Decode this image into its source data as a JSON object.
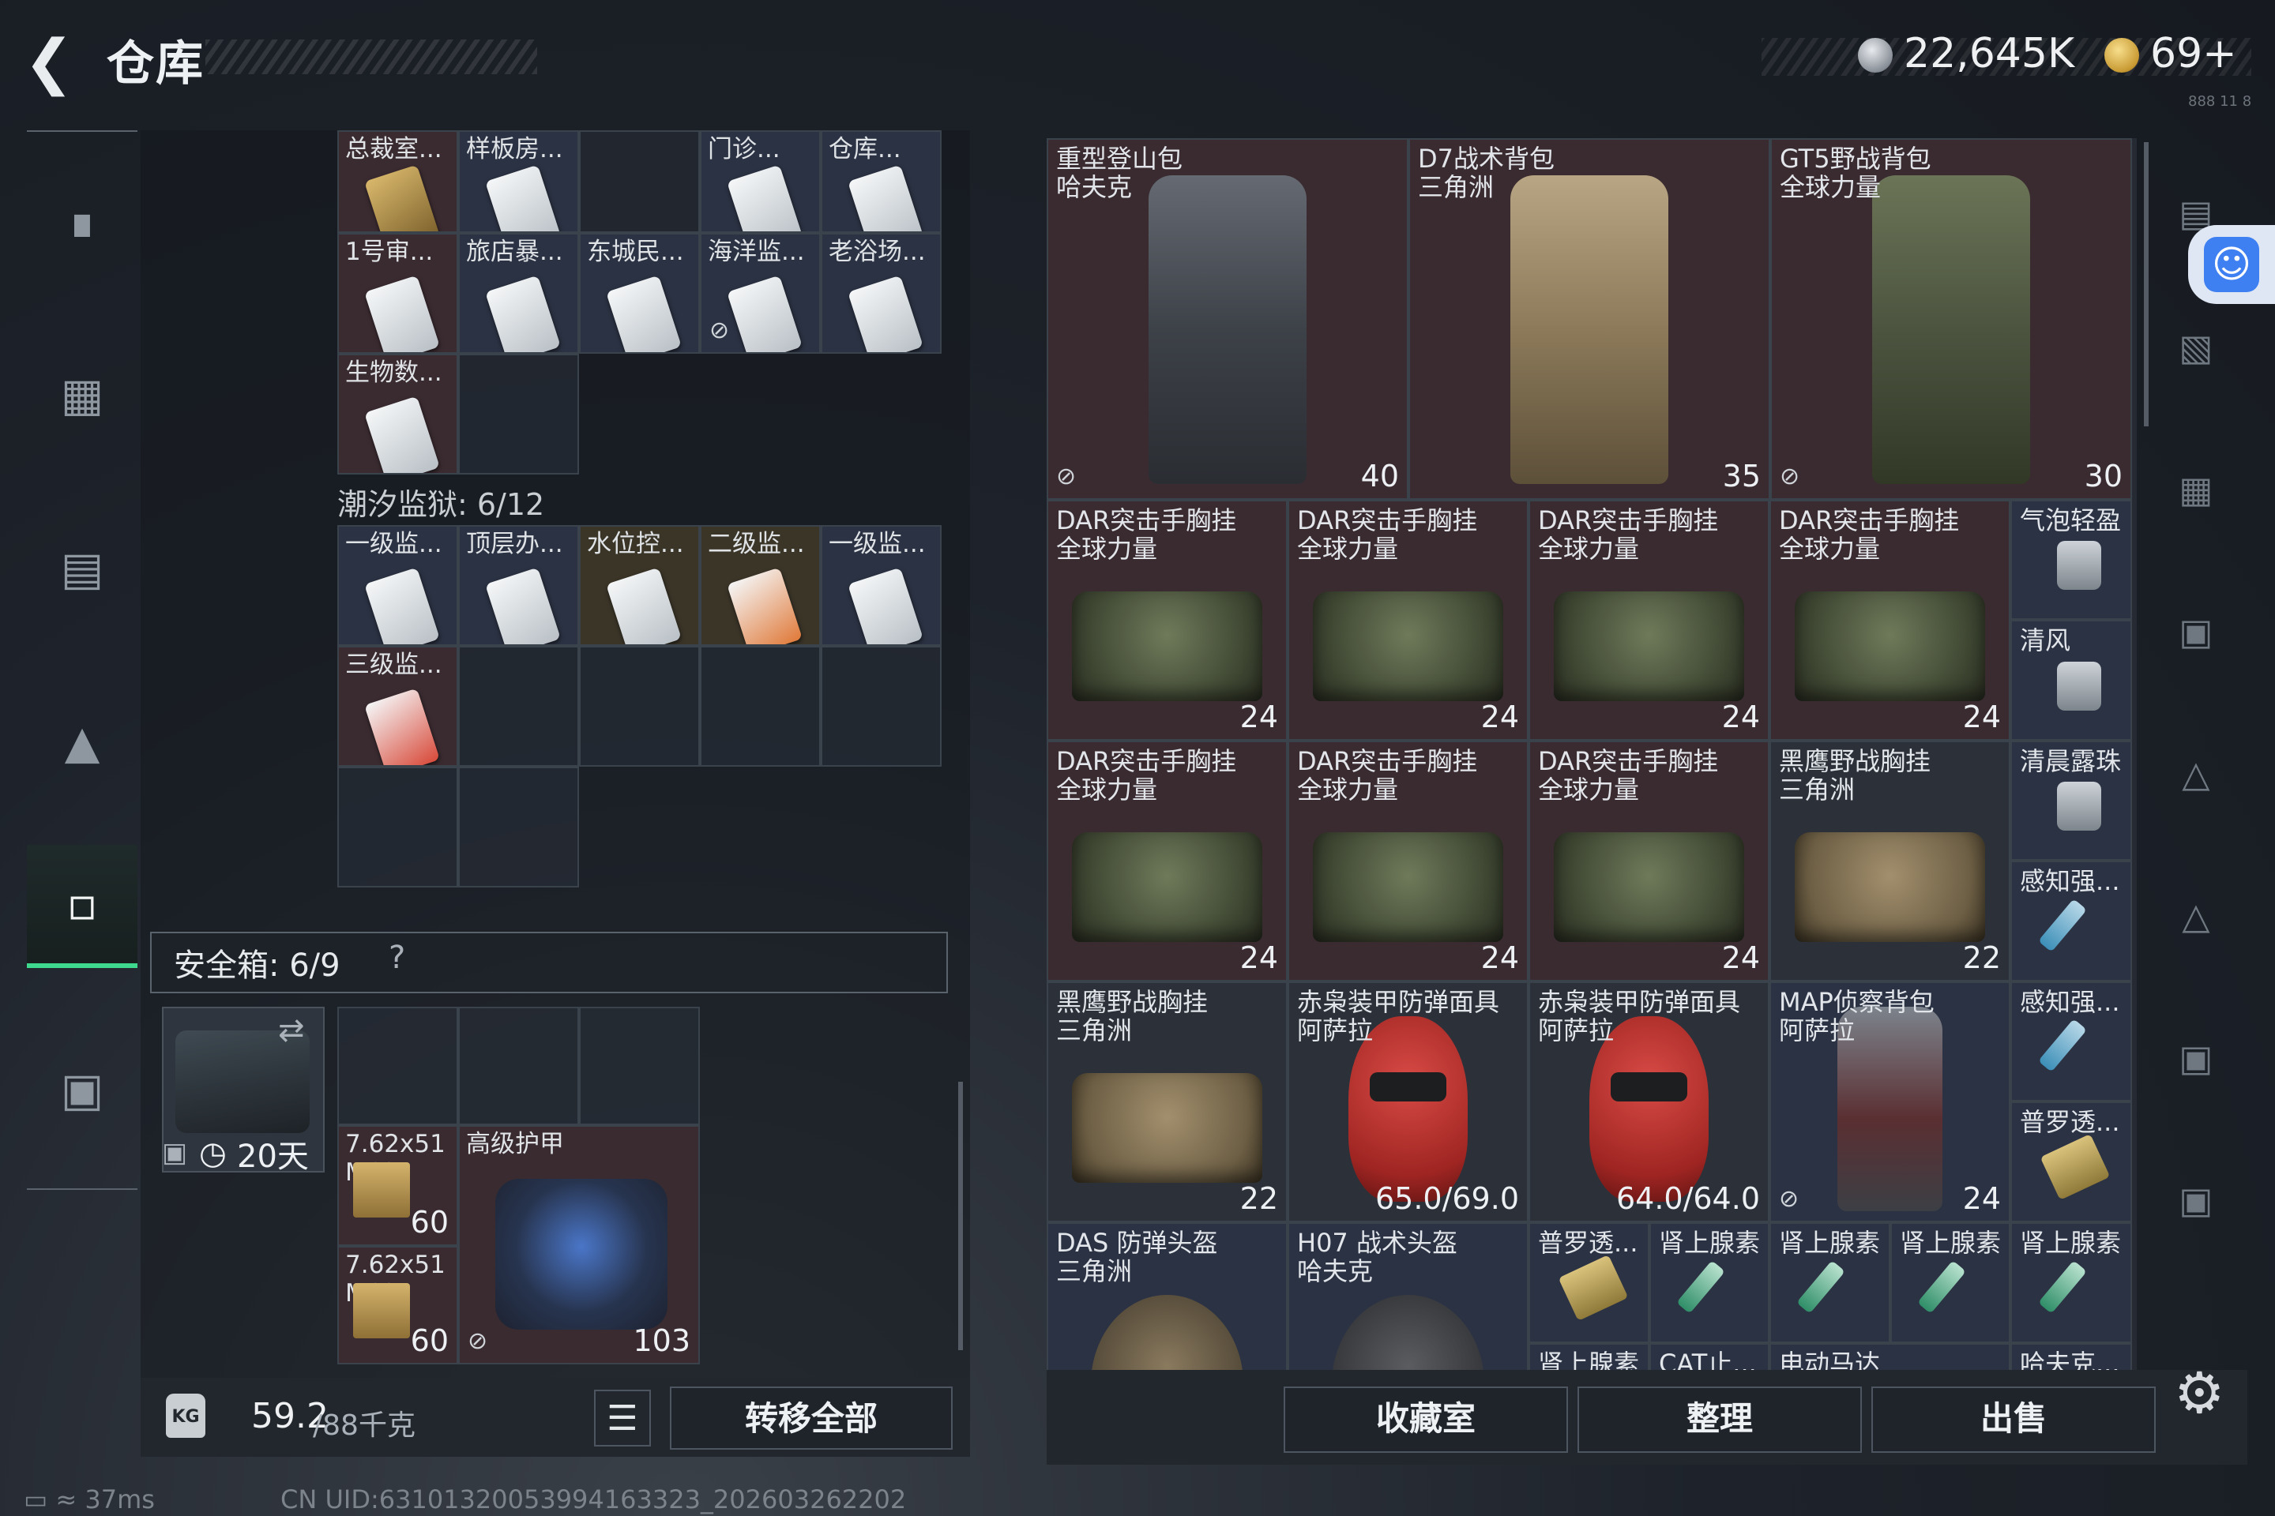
{
  "header": {
    "back_icon": "back-arrow-icon",
    "title": "仓库",
    "currency1": "22,645K",
    "currency2": "69+",
    "version_text": "888 11 8"
  },
  "left_nav": {
    "items": [
      "pistol-icon",
      "vest-icon",
      "backpack-icon",
      "helmet-icon",
      "case-icon",
      "briefcase-icon"
    ],
    "active_index": 4
  },
  "keycards_top": [
    {
      "label": "总裁室..."
    },
    {
      "label": "样板房..."
    },
    {
      "label": ""
    },
    {
      "label": "门诊..."
    },
    {
      "label": "仓库..."
    },
    {
      "label": "1号审..."
    },
    {
      "label": "旅店暴..."
    },
    {
      "label": "东城民..."
    },
    {
      "label": "海洋监..."
    },
    {
      "label": "老浴场..."
    },
    {
      "label": "生物数..."
    }
  ],
  "prison": {
    "title": "潮汐监狱: 6/12",
    "cards": [
      {
        "label": "一级监..."
      },
      {
        "label": "顶层办..."
      },
      {
        "label": "水位控..."
      },
      {
        "label": "二级监..."
      },
      {
        "label": "一级监..."
      },
      {
        "label": "三级监..."
      }
    ]
  },
  "safebox": {
    "label": "安全箱:  6/9",
    "help": "?",
    "timer": "20天"
  },
  "safe_items": [
    {
      "label": "7.62x51",
      "sub": "M62",
      "count": "60"
    },
    {
      "label": "7.62x51",
      "sub": "M62",
      "count": "60"
    },
    {
      "label": "高级护甲",
      "value": "103"
    }
  ],
  "inventory": [
    {
      "title": "重型登山包",
      "sub": "哈夫克",
      "value": "40"
    },
    {
      "title": "D7战术背包",
      "sub": "三角洲",
      "value": "35"
    },
    {
      "title": "GT5野战背包",
      "sub": "全球力量",
      "value": "30"
    },
    {
      "title": "DAR突击手胸挂",
      "sub": "全球力量",
      "value": "24"
    },
    {
      "title": "DAR突击手胸挂",
      "sub": "全球力量",
      "value": "24"
    },
    {
      "title": "DAR突击手胸挂",
      "sub": "全球力量",
      "value": "24"
    },
    {
      "title": "DAR突击手胸挂",
      "sub": "全球力量",
      "value": "24"
    },
    {
      "title": "气泡轻盈"
    },
    {
      "title": "清风"
    },
    {
      "title": "DAR突击手胸挂",
      "sub": "全球力量",
      "value": "24"
    },
    {
      "title": "DAR突击手胸挂",
      "sub": "全球力量",
      "value": "24"
    },
    {
      "title": "DAR突击手胸挂",
      "sub": "全球力量",
      "value": "24"
    },
    {
      "title": "黑鹰野战胸挂",
      "sub": "三角洲",
      "value": "22"
    },
    {
      "title": "清晨露珠"
    },
    {
      "title": "感知强..."
    },
    {
      "title": "黑鹰野战胸挂",
      "sub": "三角洲",
      "value": "22"
    },
    {
      "title": "赤枭装甲防弹面具",
      "sub": "阿萨拉",
      "value": "65.0/69.0"
    },
    {
      "title": "赤枭装甲防弹面具",
      "sub": "阿萨拉",
      "value": "64.0/64.0"
    },
    {
      "title": "MAP侦察背包",
      "sub": "阿萨拉",
      "value": "24"
    },
    {
      "title": "感知强..."
    },
    {
      "title": "普罗透..."
    },
    {
      "title": "DAS 防弹头盔",
      "sub": "三角洲"
    },
    {
      "title": "H07 战术头盔",
      "sub": "哈夫克"
    },
    {
      "title": "普罗透..."
    },
    {
      "title": "肾上腺素"
    },
    {
      "title": "肾上腺素"
    },
    {
      "title": "肾上腺素"
    },
    {
      "title": "肾上腺素"
    },
    {
      "title": "肾上腺素"
    },
    {
      "title": "CAT止..."
    },
    {
      "title": "电动马达"
    },
    {
      "title": "哈夫克..."
    }
  ],
  "bottom": {
    "weight": "59.2",
    "weight_max": "/88千克",
    "transfer_all": "转移全部",
    "collection": "收藏室",
    "sort": "整理",
    "sell": "出售"
  },
  "status": {
    "ping": "37ms",
    "uid": "CN UID:63101320053994163323_202603262202"
  },
  "colors": {
    "accent_green": "#3ed88e",
    "access_blue": "#3e7ff1"
  }
}
